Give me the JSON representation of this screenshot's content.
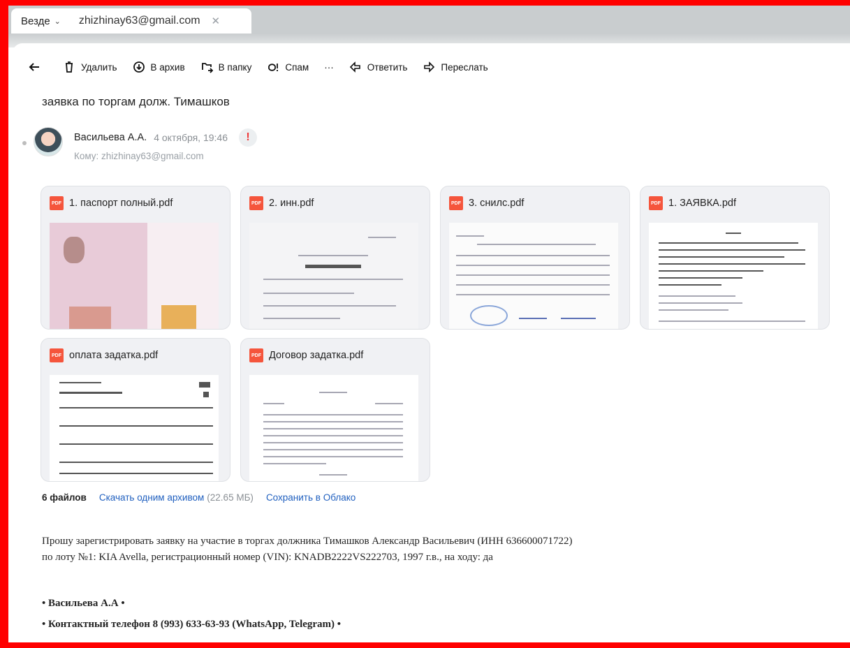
{
  "search": {
    "scope": "Везде",
    "query": "zhizhinay63@gmail.com"
  },
  "toolbar": {
    "delete": "Удалить",
    "archive": "В архив",
    "to_folder": "В папку",
    "spam": "Спам",
    "more": "···",
    "reply": "Ответить",
    "forward": "Переслать"
  },
  "message": {
    "subject": "заявка по торгам долж. Тимашков",
    "sender": "Васильева А.А.",
    "date": "4 октября, 19:46",
    "recipient": "Кому: zhizhinay63@gmail.com",
    "body_line1": "Прошу зарегистрировать заявку на участие в торгах должника Тимашков Александр Васильевич (ИНН 636600071722)",
    "body_line2": "по лоту №1: KIA Avella, регистрационный номер (VIN): KNADB2222VS222703, 1997 г.в., на ходу: да",
    "sig1": "• Васильева А.А •",
    "sig2": "• Контактный телефон 8 (993) 633-63-93 (WhatsApp, Telegram) •"
  },
  "attachments": [
    {
      "name": "1. паспорт полный.pdf"
    },
    {
      "name": "2. инн.pdf"
    },
    {
      "name": "3. снилс.pdf"
    },
    {
      "name": "1. ЗАЯВКА.pdf"
    },
    {
      "name": "оплата задатка.pdf"
    },
    {
      "name": "Договор задатка.pdf"
    }
  ],
  "attachment_summary": {
    "count": "6 файлов",
    "download": "Скачать одним архивом",
    "size": "(22.65 МБ)",
    "save": "Сохранить в Облако"
  },
  "icons": {
    "pdf_badge": "PDF"
  },
  "colors": {
    "frame": "#ff0000",
    "link": "#1f5fbf",
    "pdf": "#f5553c",
    "important": "#ef3a3a"
  }
}
